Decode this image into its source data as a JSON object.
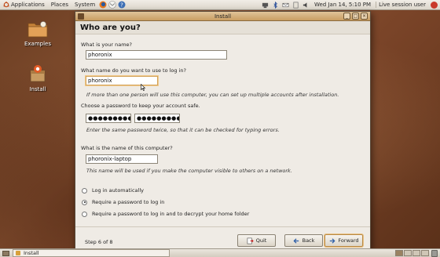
{
  "top_panel": {
    "menus": [
      {
        "label": "Applications",
        "icon": "ubuntu-logo-icon"
      },
      {
        "label": "Places",
        "icon": ""
      },
      {
        "label": "System",
        "icon": ""
      }
    ],
    "launchers": [
      "firefox-icon",
      "mail-icon",
      "help-icon"
    ],
    "tray_icons": [
      "network-icon",
      "bluetooth-icon",
      "mail-notify-icon",
      "update-icon",
      "volume-icon"
    ],
    "clock": "Wed Jan 14,  5:10 PM",
    "user_menu": "Live session user"
  },
  "desktop": {
    "icons": [
      {
        "label": "Examples",
        "icon": "folder-icon"
      },
      {
        "label": "Install",
        "icon": "installer-icon"
      }
    ]
  },
  "window": {
    "title": "Install",
    "heading": "Who are you?",
    "name_label": "What is your name?",
    "name_value": "phoronix",
    "login_label": "What name do you want to use to log in?",
    "login_value": "phoronix",
    "login_hint": "If more than one person will use this computer, you can set up multiple accounts after installation.",
    "password_label": "Choose a password to keep your account safe.",
    "password_value": "●●●●●●●●●",
    "password_confirm_value": "●●●●●●●●●",
    "password_hint": "Enter the same password twice, so that it can be checked for typing errors.",
    "computer_label": "What is the name of this computer?",
    "computer_value": "phoronix-laptop",
    "computer_hint": "This name will be used if you make the computer visible to others on a network.",
    "login_options": [
      {
        "label": "Log in automatically",
        "selected": false
      },
      {
        "label": "Require a password to log in",
        "selected": true
      },
      {
        "label": "Require a password to log in and to decrypt your home folder",
        "selected": false
      }
    ],
    "step": "Step 6 of 8",
    "buttons": {
      "quit": "Quit",
      "back": "Back",
      "forward": "Forward"
    }
  },
  "bottom_panel": {
    "task": "Install",
    "workspaces": 4
  }
}
